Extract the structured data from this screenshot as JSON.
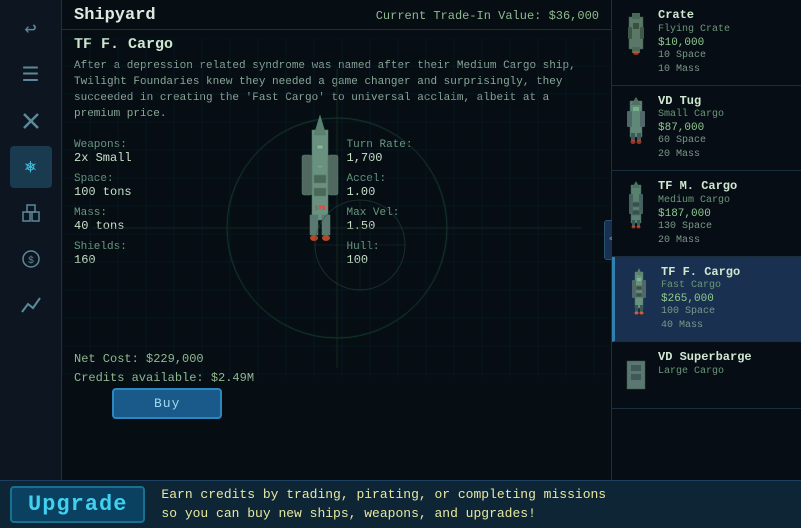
{
  "header": {
    "title": "Shipyard",
    "trade_in_label": "Current Trade-In Value:",
    "trade_in_value": "$36,000"
  },
  "selected_ship": {
    "name": "TF F. Cargo",
    "description": "After a depression related syndrome was named after their Medium Cargo ship, Twilight Foundaries knew they needed a game changer and surprisingly, they succeeded in creating the 'Fast Cargo' to universal acclaim, albeit at a premium price.",
    "stats": {
      "weapons_label": "Weapons:",
      "weapons_value": "2x Small",
      "turn_label": "Turn Rate:",
      "turn_value": "1,700",
      "space_label": "Space:",
      "space_value": "100 tons",
      "accel_label": "Accel:",
      "accel_value": "1.00",
      "mass_label": "Mass:",
      "mass_value": "40 tons",
      "max_vel_label": "Max Vel:",
      "max_vel_value": "1.50",
      "shields_label": "Shields:",
      "shields_value": "160",
      "hull_label": "Hull:",
      "hull_value": "100"
    },
    "net_cost_label": "Net Cost:",
    "net_cost_value": "$229,000",
    "credits_label": "Credits available:",
    "credits_value": "$2.49M",
    "buy_label": "Buy"
  },
  "ship_list": [
    {
      "name": "Crate",
      "type": "Flying Crate",
      "price": "$10,000",
      "stat1": "10 Space",
      "stat2": "10 Mass",
      "selected": false
    },
    {
      "name": "VD Tug",
      "type": "Small Cargo",
      "price": "$87,000",
      "stat1": "60 Space",
      "stat2": "20 Mass",
      "selected": false
    },
    {
      "name": "TF M. Cargo",
      "type": "Medium Cargo",
      "price": "$187,000",
      "stat1": "130 Space",
      "stat2": "20 Mass",
      "selected": false
    },
    {
      "name": "TF F. Cargo",
      "type": "Fast Cargo",
      "price": "$265,000",
      "stat1": "100 Space",
      "stat2": "40 Mass",
      "selected": true
    },
    {
      "name": "VD Superbarge",
      "type": "Large Cargo",
      "price": "",
      "stat1": "",
      "stat2": "",
      "selected": false
    }
  ],
  "sidebar_icons": [
    {
      "name": "back-icon",
      "symbol": "↩",
      "active": false
    },
    {
      "name": "nav-icon",
      "symbol": "☰",
      "active": false
    },
    {
      "name": "tools-icon",
      "symbol": "✦",
      "active": false
    },
    {
      "name": "helm-icon",
      "symbol": "⎈",
      "active": true
    },
    {
      "name": "cargo-icon",
      "symbol": "⊞",
      "active": false
    },
    {
      "name": "credits-icon",
      "symbol": "$",
      "active": false
    },
    {
      "name": "stats-icon",
      "symbol": "↗",
      "active": false
    }
  ],
  "upgrade_bar": {
    "label": "Upgrade",
    "text_line1": "Earn credits by trading, pirating, or completing missions",
    "text_line2": "so you can buy new ships, weapons, and upgrades!"
  }
}
